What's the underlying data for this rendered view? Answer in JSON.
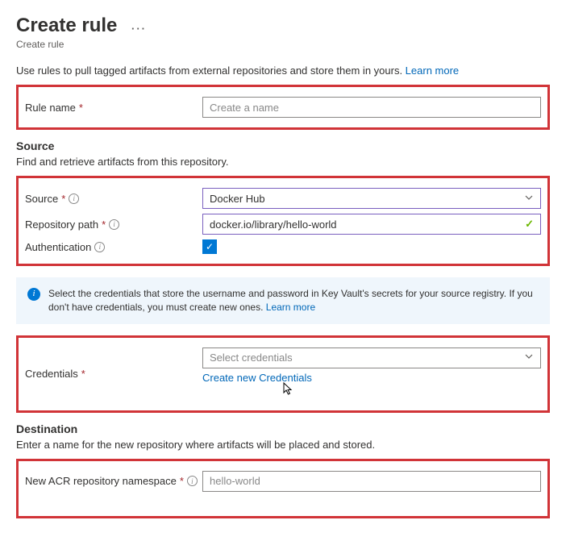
{
  "header": {
    "title": "Create rule",
    "subtitle": "Create rule"
  },
  "intro": {
    "text": "Use rules to pull tagged artifacts from external repositories and store them in yours. ",
    "learn_more": "Learn more"
  },
  "rule_name": {
    "label": "Rule name",
    "placeholder": "Create a name"
  },
  "source": {
    "title": "Source",
    "desc": "Find and retrieve artifacts from this repository.",
    "source_label": "Source",
    "source_value": "Docker Hub",
    "repo_label": "Repository path",
    "repo_value": "docker.io/library/hello-world",
    "auth_label": "Authentication"
  },
  "notice": {
    "text": "Select the credentials that store the username and password in Key Vault's secrets for your source registry. If you don't have credentials, you must create new ones. ",
    "learn_more": "Learn more"
  },
  "credentials": {
    "label": "Credentials",
    "placeholder": "Select credentials",
    "create_link": "Create new Credentials"
  },
  "destination": {
    "title": "Destination",
    "desc": "Enter a name for the new repository where artifacts will be placed and stored.",
    "ns_label": "New ACR repository namespace",
    "ns_placeholder": "hello-world"
  }
}
